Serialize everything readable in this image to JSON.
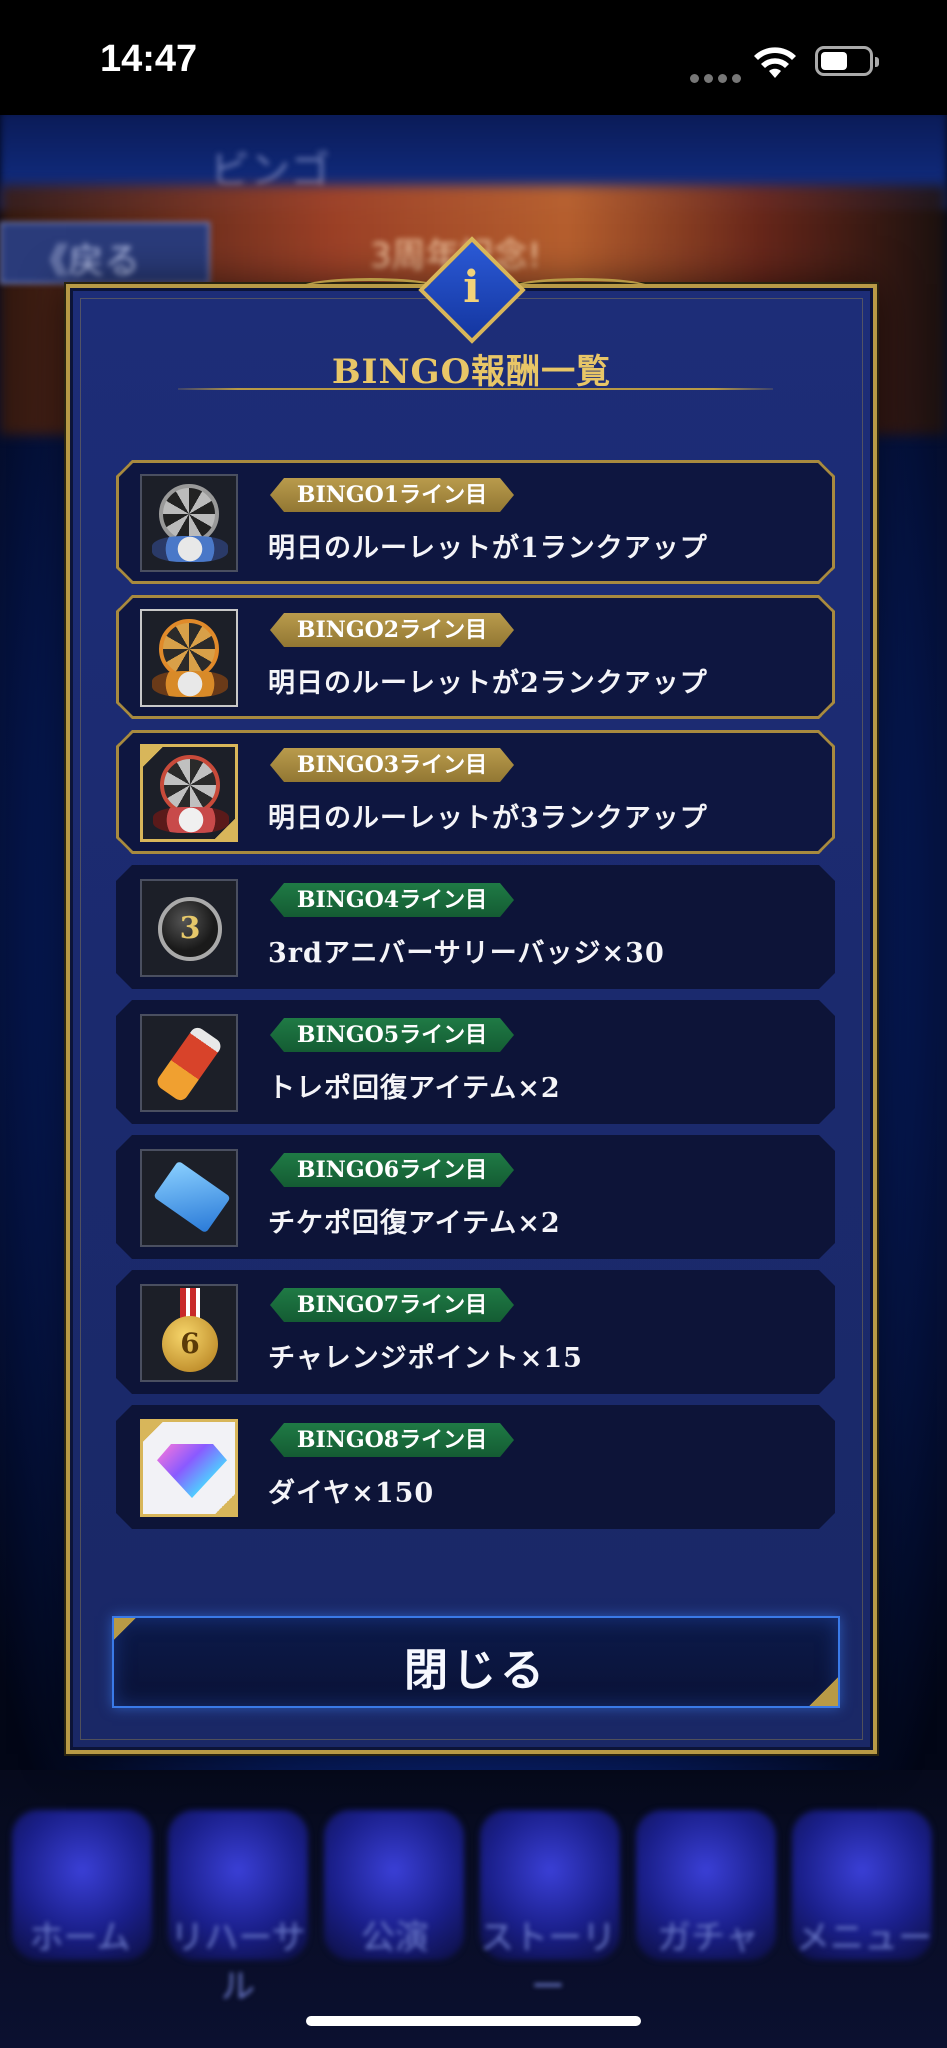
{
  "status_bar": {
    "time": "14:47"
  },
  "background": {
    "title": "ビンゴ",
    "back_label": "《戻る",
    "banner_text": "3周年記念!",
    "nav": [
      "ホーム",
      "リハーサル",
      "公演",
      "ストーリー",
      "ガチャ",
      "メニュー"
    ]
  },
  "modal": {
    "info_glyph": "i",
    "title": "BINGO報酬一覧",
    "rewards": [
      {
        "badge": "BINGO1ライン目",
        "text": "明日のルーレットが1ランクアップ",
        "tier": "gold",
        "icon": "roulette-icon"
      },
      {
        "badge": "BINGO2ライン目",
        "text": "明日のルーレットが2ランクアップ",
        "tier": "gold",
        "icon": "roulette-icon"
      },
      {
        "badge": "BINGO3ライン目",
        "text": "明日のルーレットが3ランクアップ",
        "tier": "gold",
        "icon": "roulette-icon"
      },
      {
        "badge": "BINGO4ライン目",
        "text": "3rdアニバーサリーバッジ×30",
        "tier": "green",
        "icon": "anniversary-badge-icon"
      },
      {
        "badge": "BINGO5ライン目",
        "text": "トレポ回復アイテム×2",
        "tier": "green",
        "icon": "bottle-icon"
      },
      {
        "badge": "BINGO6ライン目",
        "text": "チケポ回復アイテム×2",
        "tier": "green",
        "icon": "ticket-icon"
      },
      {
        "badge": "BINGO7ライン目",
        "text": "チャレンジポイント×15",
        "tier": "green",
        "icon": "medal-icon"
      },
      {
        "badge": "BINGO8ライン目",
        "text": "ダイヤ×150",
        "tier": "green",
        "icon": "diamond-icon"
      }
    ],
    "close_label": "閉じる"
  },
  "colors": {
    "gold": "#b89a46",
    "modal_bg": "#1b2a6e",
    "badge_green": "#1f7a45",
    "badge_gold": "#b99b4c",
    "button_border": "#3a7ae8"
  }
}
